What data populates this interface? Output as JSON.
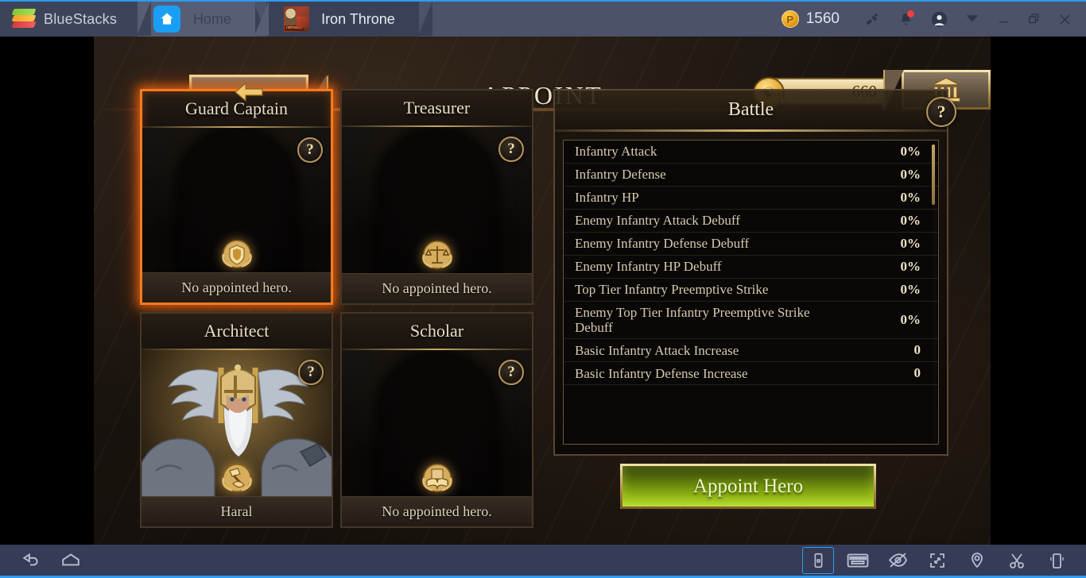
{
  "titlebar": {
    "brand": "BlueStacks",
    "brand_icon": "bluestacks-logo-icon",
    "tabs": [
      {
        "label": "Home",
        "icon": "home-icon",
        "active": false
      },
      {
        "label": "Iron Throne",
        "icon": "iron-throne-app-icon",
        "active": true
      }
    ],
    "points": {
      "value": "1560",
      "icon": "points-coin-icon"
    },
    "icons": [
      "megaphone-icon",
      "notification-bell-icon",
      "user-avatar-icon",
      "chevron-down-icon"
    ],
    "window_controls": [
      "minimize-button",
      "restore-button",
      "close-button"
    ]
  },
  "game": {
    "header": {
      "back_icon": "back-arrow-icon",
      "title": "APPOINT",
      "currency": {
        "value": "660",
        "icon": "gold-coin-icon",
        "plus": "+"
      },
      "bank_icon": "bank-building-icon"
    },
    "cards": [
      {
        "title": "Guard Captain",
        "status": "No appointed hero.",
        "emblem": "shield-laurel-emblem",
        "help": "?",
        "selected": true,
        "has_hero": false
      },
      {
        "title": "Treasurer",
        "status": "No appointed hero.",
        "emblem": "scales-laurel-emblem",
        "help": "?",
        "selected": false,
        "has_hero": false
      },
      {
        "title": "Architect",
        "status": "Haral",
        "emblem": "hammer-laurel-emblem",
        "help": "?",
        "selected": false,
        "has_hero": true
      },
      {
        "title": "Scholar",
        "status": "No appointed hero.",
        "emblem": "book-laurel-emblem",
        "help": "?",
        "selected": false,
        "has_hero": false
      }
    ],
    "stats_panel": {
      "title": "Battle",
      "help": "?",
      "rows": [
        {
          "name": "Infantry Attack",
          "value": "0%"
        },
        {
          "name": "Infantry Defense",
          "value": "0%"
        },
        {
          "name": "Infantry HP",
          "value": "0%"
        },
        {
          "name": "Enemy Infantry Attack Debuff",
          "value": "0%"
        },
        {
          "name": "Enemy Infantry Defense Debuff",
          "value": "0%"
        },
        {
          "name": "Enemy Infantry HP Debuff",
          "value": "0%"
        },
        {
          "name": "Top Tier Infantry Preemptive Strike",
          "value": "0%"
        },
        {
          "name": "Enemy Top Tier Infantry Preemptive Strike Debuff",
          "value": "0%"
        },
        {
          "name": "Basic Infantry Attack Increase",
          "value": "0"
        },
        {
          "name": "Basic Infantry Defense Increase",
          "value": "0"
        }
      ]
    },
    "appoint_button": "Appoint Hero"
  },
  "bottombar": {
    "left_icons": [
      "android-back-icon",
      "android-home-icon"
    ],
    "right_icons": [
      "rotate-portrait-icon",
      "keyboard-icon",
      "eye-slash-icon",
      "fullscreen-icon",
      "location-pin-icon",
      "scissors-icon",
      "shake-phone-icon"
    ]
  },
  "colors": {
    "accent_blue": "#2d9cf0",
    "selected_orange": "#ff7a1c",
    "gold": "#d4b473",
    "green_button": "#8fb315"
  }
}
